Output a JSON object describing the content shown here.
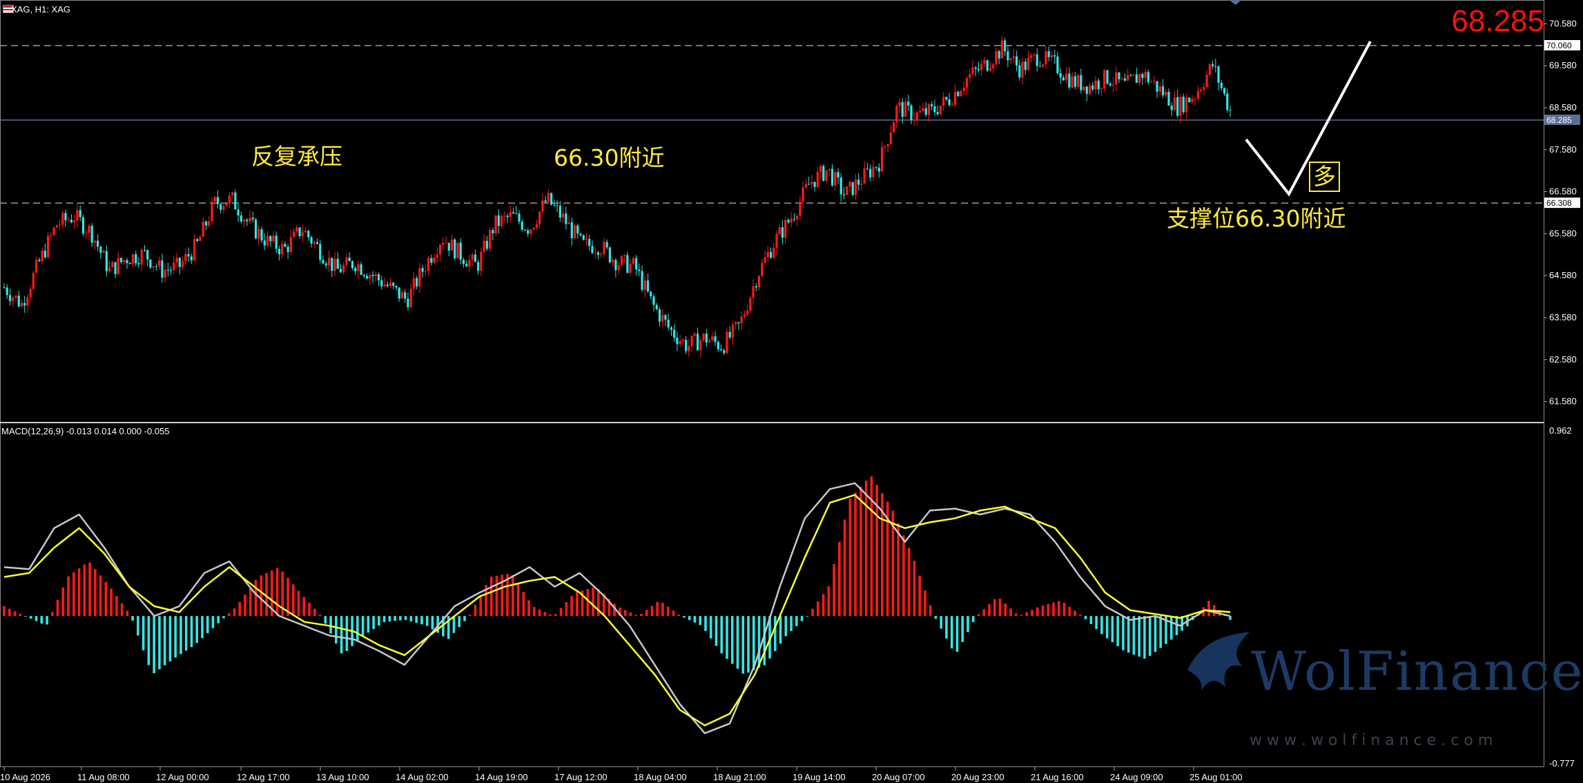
{
  "header": {
    "symbol_title": "XAG, H1: XAG",
    "current_price_big": "68.285"
  },
  "annotations": {
    "resistance_text": "反复承压",
    "resistance_level_text": "66.30附近",
    "long_box": "多",
    "support_text": "支撑位66.30附近"
  },
  "macd": {
    "label": "MACD(12,26,9) -0.013 0.014 0.000 -0.055",
    "axis_top": "0.962",
    "axis_bottom": "-0.777"
  },
  "watermark": {
    "brand": "WolFinance",
    "url": "w w w . w o l f i n a n c e . c o m"
  },
  "colors": {
    "background": "#000000",
    "bull": "#ff1a1a",
    "bear": "#33e6e6",
    "signal": "#ffff33",
    "macd_line": "#c8c8c8",
    "annotation": "#ffeb3b",
    "big_price": "#ff1010"
  },
  "chart_data": {
    "type": "candlestick",
    "symbol": "XAG",
    "timeframe": "H1",
    "price_ylim": [
      61.08,
      71.08
    ],
    "price_ticks": [
      "70.580",
      "69.580",
      "68.580",
      "67.580",
      "66.580",
      "65.580",
      "64.580",
      "63.580",
      "62.580",
      "61.580"
    ],
    "price_tick_values": [
      70.58,
      69.58,
      68.58,
      67.58,
      66.58,
      65.58,
      64.58,
      63.58,
      62.58,
      61.58
    ],
    "x_labels": [
      "10 Aug 2026",
      "11 Aug 08:00",
      "12 Aug 00:00",
      "12 Aug 17:00",
      "13 Aug 10:00",
      "14 Aug 02:00",
      "14 Aug 19:00",
      "17 Aug 12:00",
      "18 Aug 04:00",
      "18 Aug 21:00",
      "19 Aug 14:00",
      "20 Aug 07:00",
      "20 Aug 23:00",
      "21 Aug 16:00",
      "24 Aug 09:00",
      "25 Aug 01:00"
    ],
    "levels": [
      {
        "value": 70.06,
        "label": "70.060",
        "style": "dashed"
      },
      {
        "value": 68.285,
        "label": "68.285",
        "style": "solid"
      },
      {
        "value": 66.308,
        "label": "66.308",
        "style": "dashed"
      }
    ],
    "close_path": [
      64.3,
      63.9,
      64.9,
      65.8,
      66.0,
      65.6,
      64.7,
      65.0,
      65.1,
      64.7,
      64.8,
      65.3,
      66.3,
      66.4,
      65.8,
      65.4,
      65.2,
      65.7,
      65.2,
      64.7,
      64.9,
      64.6,
      64.3,
      64.0,
      64.8,
      65.5,
      65.1,
      64.8,
      65.8,
      66.0,
      65.7,
      66.4,
      65.9,
      65.3,
      65.3,
      64.9,
      64.8,
      63.9,
      63.3,
      62.9,
      63.1,
      62.9,
      63.4,
      64.6,
      65.4,
      66.0,
      66.8,
      67.1,
      66.5,
      66.9,
      67.3,
      68.6,
      68.4,
      68.5,
      68.8,
      69.3,
      69.6,
      70.0,
      69.5,
      69.8,
      69.6,
      69.2,
      69.1,
      69.3,
      69.1,
      69.4,
      69.0,
      68.6,
      68.9,
      69.6,
      68.5
    ]
  },
  "macd_data": {
    "ylim": [
      -0.777,
      0.962
    ],
    "histogram_path": [
      0.05,
      0.0,
      -0.05,
      0.2,
      0.28,
      0.15,
      0.0,
      -0.3,
      -0.22,
      -0.15,
      -0.05,
      0.05,
      0.2,
      0.25,
      0.12,
      0.0,
      -0.2,
      -0.1,
      -0.03,
      -0.02,
      -0.05,
      -0.12,
      0.0,
      0.2,
      0.22,
      0.05,
      0.0,
      0.12,
      0.15,
      0.05,
      0.0,
      0.08,
      0.0,
      -0.05,
      -0.2,
      -0.3,
      -0.25,
      -0.1,
      0.0,
      0.15,
      0.6,
      0.72,
      0.55,
      0.3,
      0.0,
      -0.2,
      0.0,
      0.1,
      0.0,
      0.05,
      0.08,
      0.0,
      -0.1,
      -0.18,
      -0.22,
      -0.14,
      -0.05,
      0.08,
      -0.02
    ],
    "macd_path": [
      0.25,
      0.24,
      0.45,
      0.52,
      0.35,
      0.15,
      0.0,
      0.05,
      0.22,
      0.28,
      0.12,
      0.0,
      -0.05,
      -0.1,
      -0.12,
      -0.18,
      -0.25,
      -0.1,
      0.05,
      0.12,
      0.18,
      0.25,
      0.15,
      0.22,
      0.1,
      -0.05,
      -0.25,
      -0.45,
      -0.6,
      -0.55,
      -0.25,
      0.15,
      0.5,
      0.65,
      0.68,
      0.55,
      0.38,
      0.54,
      0.55,
      0.52,
      0.55,
      0.52,
      0.38,
      0.2,
      0.05,
      -0.02,
      0.0,
      -0.05,
      0.03,
      0.0
    ],
    "signal_path": [
      0.2,
      0.22,
      0.35,
      0.45,
      0.32,
      0.15,
      0.05,
      0.02,
      0.15,
      0.25,
      0.15,
      0.05,
      -0.03,
      -0.05,
      -0.08,
      -0.15,
      -0.2,
      -0.1,
      0.0,
      0.1,
      0.15,
      0.18,
      0.2,
      0.12,
      0.0,
      -0.15,
      -0.3,
      -0.48,
      -0.56,
      -0.5,
      -0.3,
      0.0,
      0.3,
      0.58,
      0.62,
      0.5,
      0.45,
      0.48,
      0.5,
      0.54,
      0.56,
      0.5,
      0.45,
      0.3,
      0.12,
      0.03,
      0.01,
      -0.01,
      0.03,
      0.02
    ]
  }
}
